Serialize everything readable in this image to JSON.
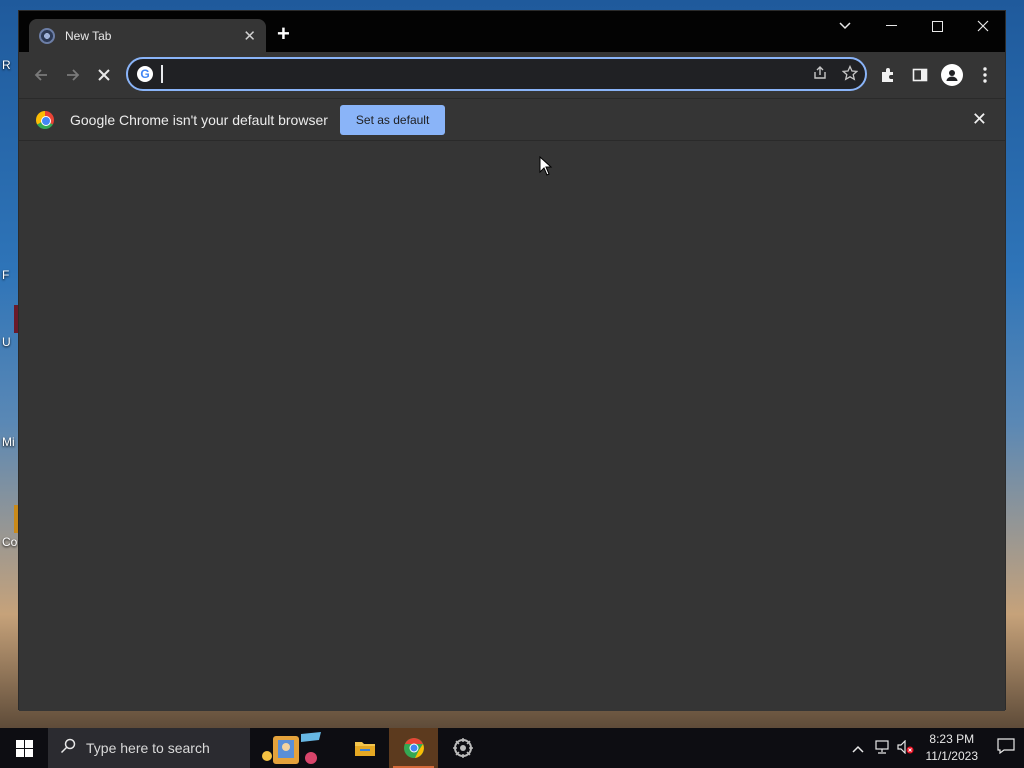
{
  "desktop": {
    "icons": [
      {
        "label": "R"
      },
      {
        "label": "F"
      },
      {
        "label": "U"
      },
      {
        "label": "Mi"
      },
      {
        "label": "Co"
      }
    ]
  },
  "browser": {
    "tab": {
      "title": "New Tab"
    },
    "omnibox": {
      "value": "",
      "placeholder": ""
    },
    "infobar": {
      "message": "Google Chrome isn't your default browser",
      "button_label": "Set as default"
    }
  },
  "taskbar": {
    "search_placeholder": "Type here to search",
    "clock": {
      "time": "8:23 PM",
      "date": "11/1/2023"
    }
  },
  "colors": {
    "window_bg": "#353535",
    "tabstrip_bg": "#030303",
    "accent": "#8ab4f8"
  }
}
